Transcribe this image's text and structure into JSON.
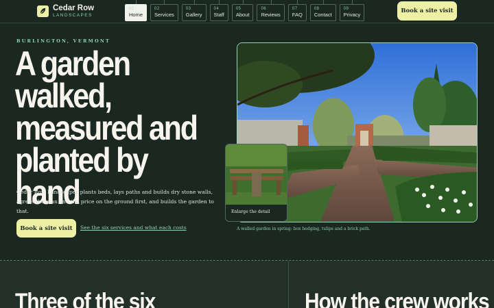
{
  "brand": {
    "name": "Cedar Row",
    "tagline": "LANDSCAPES",
    "logo_icon": "leaf-icon",
    "accent": "#eef0a6",
    "mint": "#8ed2b4"
  },
  "nav": {
    "items": [
      {
        "num": "01",
        "label": "Home",
        "active": true
      },
      {
        "num": "02",
        "label": "Services"
      },
      {
        "num": "03",
        "label": "Gallery"
      },
      {
        "num": "04",
        "label": "Staff"
      },
      {
        "num": "05",
        "label": "About"
      },
      {
        "num": "06",
        "label": "Reviews"
      },
      {
        "num": "07",
        "label": "FAQ"
      },
      {
        "num": "08",
        "label": "Contact"
      },
      {
        "num": "09",
        "label": "Privacy"
      }
    ],
    "cta": "Book a site visit"
  },
  "hero": {
    "eyebrow": "BURLINGTON, VERMONT",
    "headline": "A garden walked, measured and planted by hand",
    "intro": "Cedar Row Landscapes plants beds, lays paths and builds dry stone walls, agrees the plan and the price on the ground first, and builds the garden to that.",
    "cta": "Book a site visit",
    "link": "See the six services and what each costs",
    "photo_caption": "A walled garden in spring: box hedging, tulips and a brick path.",
    "detail_label": "Enlarge the detail"
  },
  "sections": {
    "left_title": "Three of the six",
    "right_title": "How the crew works"
  }
}
